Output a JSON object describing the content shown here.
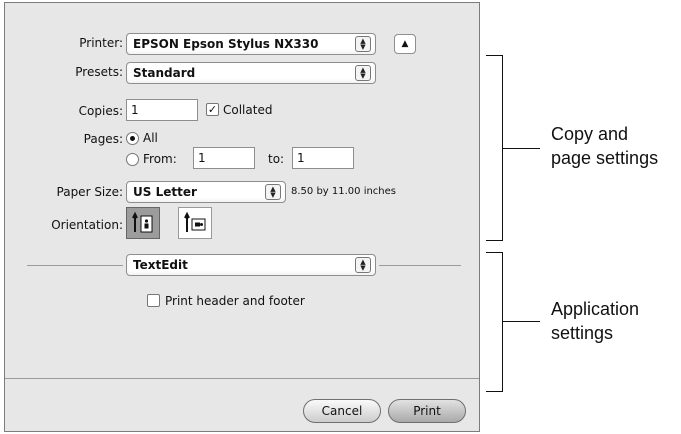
{
  "printer": {
    "label": "Printer:",
    "value": "EPSON Epson Stylus NX330"
  },
  "presets": {
    "label": "Presets:",
    "value": "Standard"
  },
  "copies": {
    "label": "Copies:",
    "value": "1",
    "collated_label": "Collated",
    "collated_checked": true
  },
  "pages": {
    "label": "Pages:",
    "all_label": "All",
    "from_label": "From:",
    "from_value": "1",
    "to_label": "to:",
    "to_value": "1",
    "selected": "all"
  },
  "paper_size": {
    "label": "Paper Size:",
    "value": "US Letter",
    "dimensions": "8.50 by 11.00 inches"
  },
  "orientation": {
    "label": "Orientation:",
    "selected": "portrait"
  },
  "app_section": {
    "value": "TextEdit",
    "header_footer_label": "Print header and footer",
    "header_footer_checked": false
  },
  "buttons": {
    "cancel": "Cancel",
    "print": "Print"
  },
  "annotations": {
    "copy_page": [
      "Copy and",
      "page settings"
    ],
    "application": [
      "Application",
      "settings"
    ]
  },
  "icons": {
    "stepper": "up-down-arrows-icon",
    "disclosure": "triangle-up-icon",
    "portrait": "portrait-orientation-icon",
    "landscape": "landscape-orientation-icon",
    "checkmark": "checkmark-icon"
  }
}
